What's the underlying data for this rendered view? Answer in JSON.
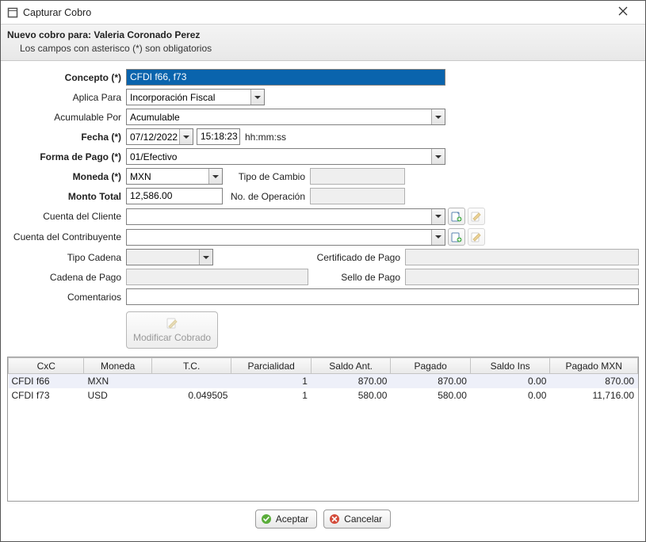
{
  "window": {
    "title": "Capturar Cobro"
  },
  "subheader": {
    "line1": "Nuevo cobro para: Valeria Coronado Perez",
    "line2": "Los campos con asterisco (*) son obligatorios"
  },
  "labels": {
    "concepto": "Concepto (*)",
    "aplica": "Aplica Para",
    "acumulable": "Acumulable Por",
    "fecha": "Fecha (*)",
    "hhmmss": "hh:mm:ss",
    "formaPago": "Forma de Pago (*)",
    "moneda": "Moneda (*)",
    "tipoCambio": "Tipo de Cambio",
    "montoTotal": "Monto Total",
    "noOperacion": "No. de Operación",
    "cuentaCliente": "Cuenta del Cliente",
    "cuentaContrib": "Cuenta del Contribuyente",
    "tipoCadena": "Tipo Cadena",
    "certPago": "Certificado de Pago",
    "cadenaPago": "Cadena de Pago",
    "selloPago": "Sello de Pago",
    "comentarios": "Comentarios",
    "modificar": "Modificar Cobrado",
    "aceptar": "Aceptar",
    "cancelar": "Cancelar"
  },
  "form": {
    "concepto": "CFDI f66, f73",
    "aplica": "Incorporación Fiscal",
    "acumulable": "Acumulable",
    "fecha": "07/12/2022",
    "hora": "15:18:23",
    "formaPago": "01/Efectivo",
    "moneda": "MXN",
    "tipoCambio": "",
    "montoTotal": "12,586.00",
    "noOperacion": "",
    "cuentaCliente": "",
    "cuentaContrib": "",
    "tipoCadena": "",
    "certPago": "",
    "cadenaPago": "",
    "selloPago": "",
    "comentarios": ""
  },
  "grid": {
    "columns": [
      "CxC",
      "Moneda",
      "T.C.",
      "Parcialidad",
      "Saldo Ant.",
      "Pagado",
      "Saldo Ins",
      "Pagado MXN"
    ],
    "rows": [
      {
        "cxc": "CFDI f66",
        "moneda": "MXN",
        "tc": "",
        "parc": "1",
        "saldoAnt": "870.00",
        "pagado": "870.00",
        "saldoIns": "0.00",
        "pagadoMxn": "870.00"
      },
      {
        "cxc": "CFDI f73",
        "moneda": "USD",
        "tc": "0.049505",
        "parc": "1",
        "saldoAnt": "580.00",
        "pagado": "580.00",
        "saldoIns": "0.00",
        "pagadoMxn": "11,716.00"
      }
    ]
  }
}
